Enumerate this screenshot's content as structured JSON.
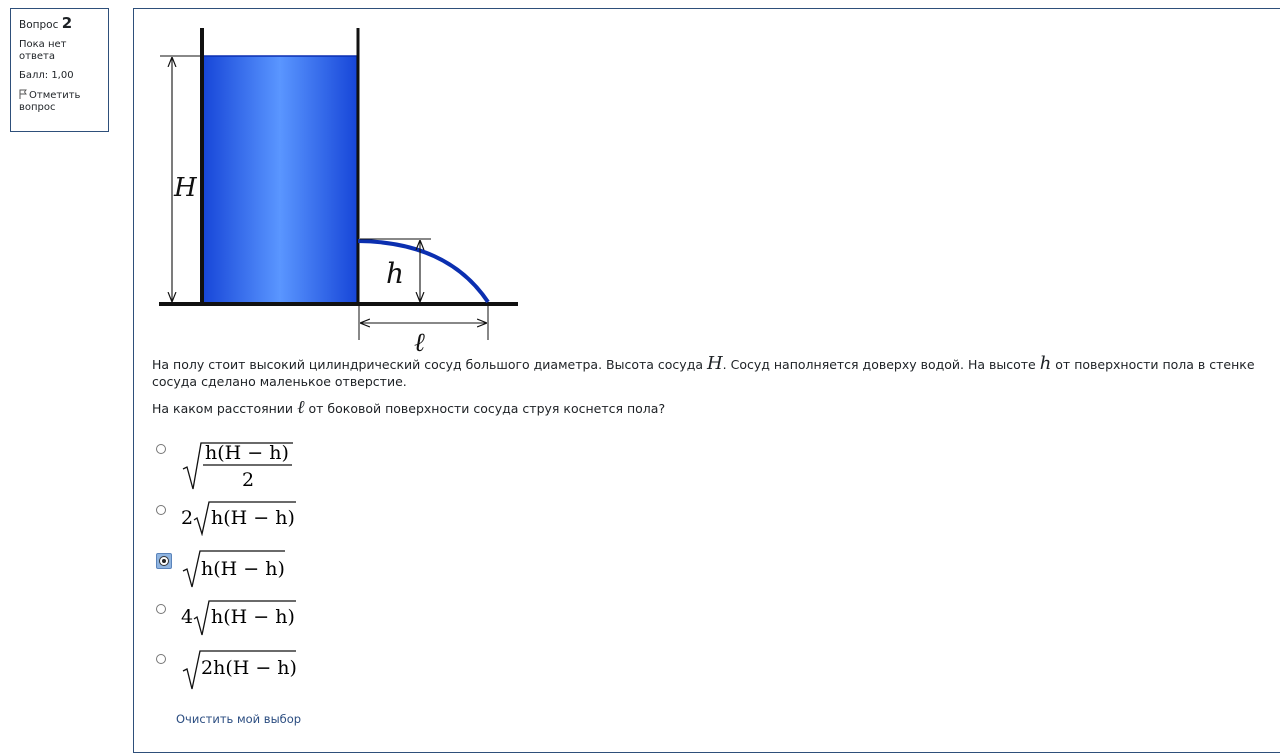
{
  "question_info": {
    "question_word": "Вопрос",
    "question_number": "2",
    "state": "Пока нет ответа",
    "grade": "Балл: 1,00",
    "flag_label": "Отметить вопрос"
  },
  "question": {
    "text_part1": "На полу стоит высокий цилиндрический сосуд большого диаметра. Высота сосуда ",
    "var_H": "H",
    "text_part2": ". Сосуд наполняется доверху водой. На высоте ",
    "var_h": "h",
    "text_part3": " от поверхности пола в стенке сосуда сделано маленькое отверстие.",
    "prompt_part1": "На каком расстоянии ",
    "var_l": "ℓ",
    "prompt_part2": " от боковой поверхности сосуда струя коснется пола?"
  },
  "diagram": {
    "label_H": "H",
    "label_h": "h",
    "label_l": "ℓ",
    "water_color": "#3d7cf0",
    "water_edge_color": "#0b2fb0"
  },
  "options": [
    {
      "formula": "sqrt(h(H − h)/2)",
      "coef": "",
      "num": "h(H − h)",
      "den": "2",
      "selected": false
    },
    {
      "formula": "2·sqrt(h(H − h))",
      "coef": "2",
      "radicand": "h(H − h)",
      "selected": false
    },
    {
      "formula": "sqrt(h(H − h))",
      "coef": "",
      "radicand": "h(H − h)",
      "selected": true
    },
    {
      "formula": "4·sqrt(h(H − h))",
      "coef": "4",
      "radicand": "h(H − h)",
      "selected": false
    },
    {
      "formula": "sqrt(2h(H − h))",
      "coef": "",
      "radicand": "2h(H − h)",
      "selected": false
    }
  ],
  "clear_choice_label": "Очистить мой выбор",
  "colors": {
    "border": "#2e4f7a",
    "link": "#2a4c80",
    "radio_selected": "#8fb4e0"
  }
}
